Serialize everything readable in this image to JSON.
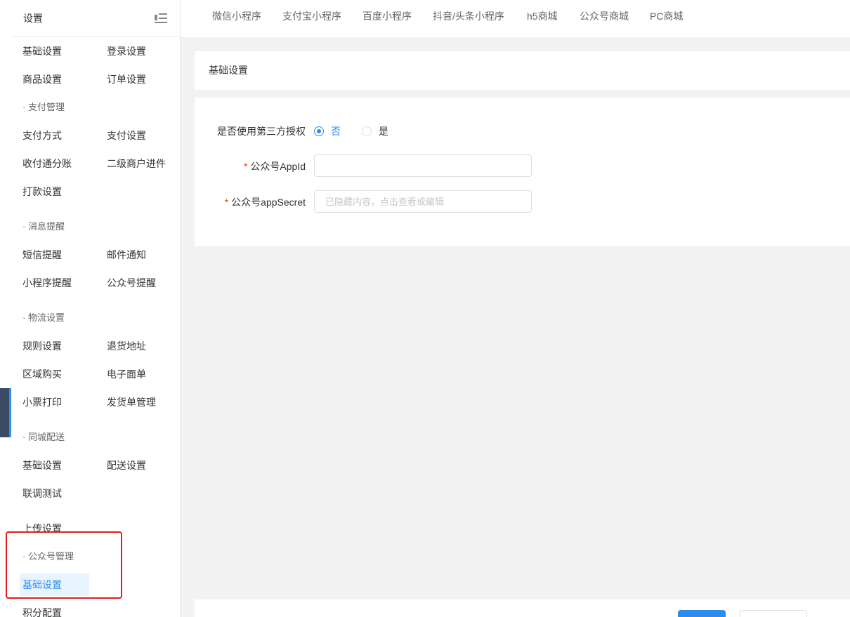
{
  "sidebar": {
    "title": "设置",
    "rows": [
      {
        "c1": "基础设置",
        "c2": "登录设置"
      },
      {
        "c1": "商品设置",
        "c2": "订单设置"
      },
      {
        "group": "· 支付管理"
      },
      {
        "c1": "支付方式",
        "c2": "支付设置"
      },
      {
        "c1": "收付通分账",
        "c2": "二级商户进件"
      },
      {
        "c1": "打款设置"
      },
      {
        "group": "· 消息提醒"
      },
      {
        "c1": "短信提醒",
        "c2": "邮件通知"
      },
      {
        "c1": "小程序提醒",
        "c2": "公众号提醒"
      },
      {
        "group": "· 物流设置"
      },
      {
        "c1": "规则设置",
        "c2": "退货地址"
      },
      {
        "c1": "区域购买",
        "c2": "电子面单"
      },
      {
        "c1": "小票打印",
        "c2": "发货单管理"
      },
      {
        "group": "· 同城配送"
      },
      {
        "c1": "基础设置",
        "c2": "配送设置"
      },
      {
        "c1": "联调测试"
      },
      {
        "c1": "上传设置"
      },
      {
        "group": "· 公众号管理"
      },
      {
        "c1": "基础设置",
        "active": true
      },
      {
        "c1": "积分配置"
      }
    ]
  },
  "tabs": [
    "微信小程序",
    "支付宝小程序",
    "百度小程序",
    "抖音/头条小程序",
    "h5商城",
    "公众号商城",
    "PC商城"
  ],
  "card_title": "基础设置",
  "form": {
    "third_party_label": "是否使用第三方授权",
    "option_no": "否",
    "option_yes": "是",
    "selected": "否",
    "appid_label": "公众号AppId",
    "appid_value": "",
    "appsecret_label": "公众号appSecret",
    "appsecret_placeholder": "已隐藏内容，点击查看或编辑",
    "required_mark": "*"
  }
}
